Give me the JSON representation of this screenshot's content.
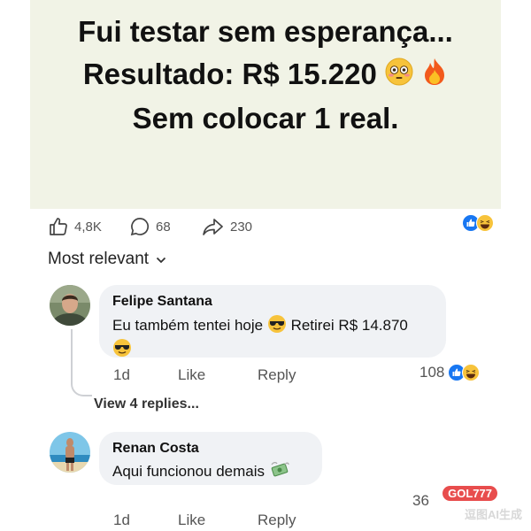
{
  "post": {
    "line1": "Fui testar sem esperança...",
    "line2": "Resultado: R$ 15.220",
    "line3": "Sem colocar 1 real.",
    "line2_emojis": [
      "flushed-face",
      "fire"
    ]
  },
  "stats": {
    "likes": "4,8K",
    "comments": "68",
    "shares": "230"
  },
  "sort_label": "Most relevant",
  "comments": [
    {
      "author": "Felipe Santana",
      "text_part1": "Eu também tentei hoje",
      "text_part2": "Retirei R$ 14.870",
      "time": "1d",
      "like": "Like",
      "reply": "Reply",
      "reaction_count": "108",
      "view_replies": "View 4 replies..."
    },
    {
      "author": "Renan Costa",
      "text": "Aqui funcionou demais",
      "time": "1d",
      "like": "Like",
      "reply": "Reply",
      "reaction_count": "36"
    }
  ],
  "watermark": {
    "badge": "GOL777",
    "text": "逗图AI生成"
  },
  "colors": {
    "like_blue": "#1877f2",
    "haha_yellow": "#f7c33b"
  }
}
